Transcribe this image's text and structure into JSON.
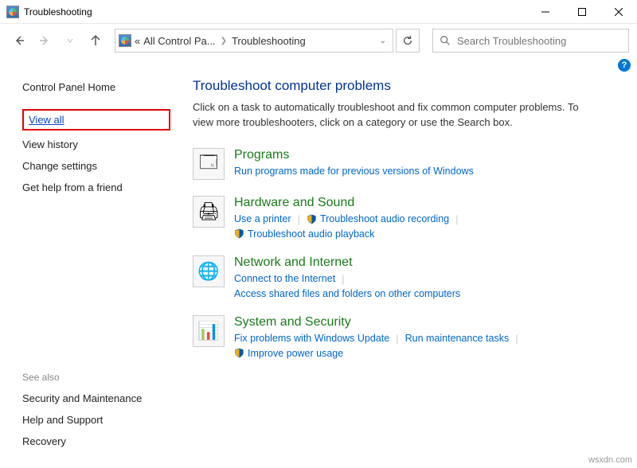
{
  "window": {
    "title": "Troubleshooting"
  },
  "address": {
    "crumb1": "All Control Pa...",
    "crumb2": "Troubleshooting",
    "prefix": "«"
  },
  "search": {
    "placeholder": "Search Troubleshooting"
  },
  "sidebar": {
    "cp_home": "Control Panel Home",
    "view_all": "View all",
    "view_history": "View history",
    "change_settings": "Change settings",
    "get_help": "Get help from a friend",
    "see_also_label": "See also",
    "security_maintenance": "Security and Maintenance",
    "help_support": "Help and Support",
    "recovery": "Recovery"
  },
  "main": {
    "heading": "Troubleshoot computer problems",
    "description": "Click on a task to automatically troubleshoot and fix common computer problems. To view more troubleshooters, click on a category or use the Search box."
  },
  "categories": {
    "programs": {
      "title": "Programs",
      "link1": "Run programs made for previous versions of Windows"
    },
    "hardware": {
      "title": "Hardware and Sound",
      "link1": "Use a printer",
      "link2": "Troubleshoot audio recording",
      "link3": "Troubleshoot audio playback"
    },
    "network": {
      "title": "Network and Internet",
      "link1": "Connect to the Internet",
      "link2": "Access shared files and folders on other computers"
    },
    "system": {
      "title": "System and Security",
      "link1": "Fix problems with Windows Update",
      "link2": "Run maintenance tasks",
      "link3": "Improve power usage"
    }
  },
  "watermark": "wsxdn.com"
}
